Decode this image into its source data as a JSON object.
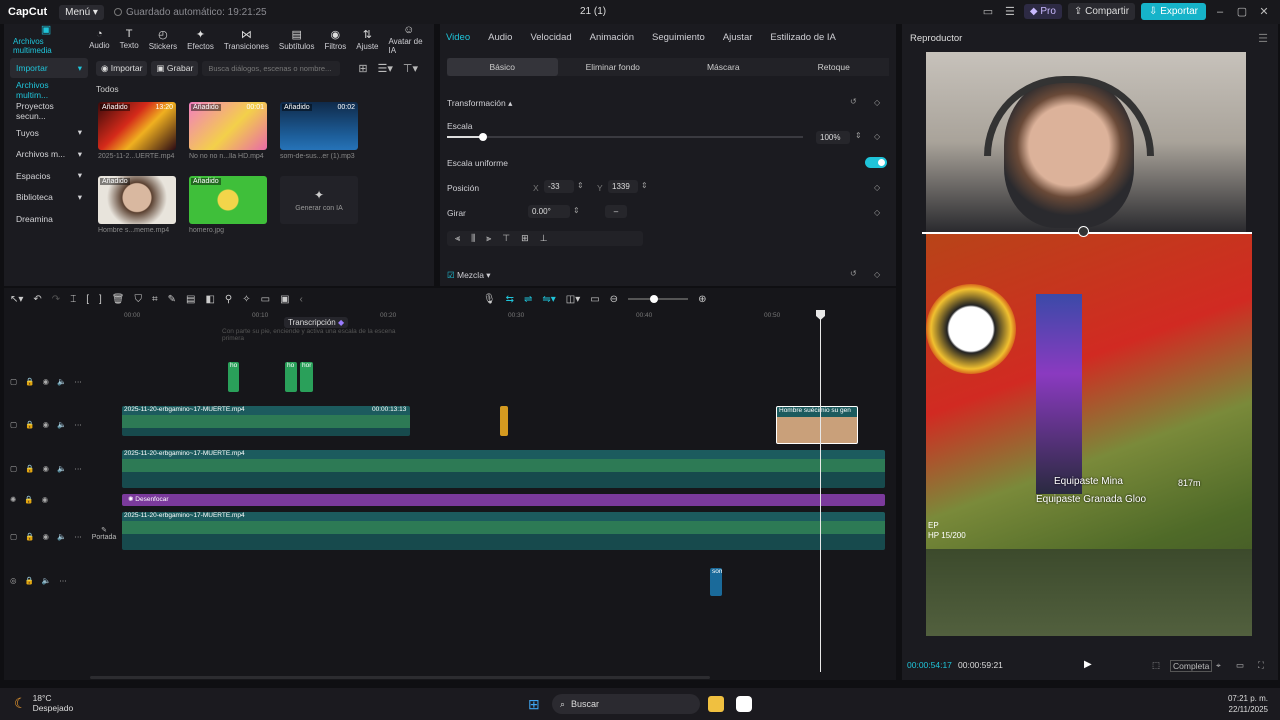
{
  "titlebar": {
    "logo": "CapCut",
    "menu": "Menú",
    "autosave": "Guardado automático: 19:21:25",
    "project": "21 (1)",
    "pro": "Pro",
    "share": "Compartir",
    "export": "Exportar"
  },
  "tools": [
    "Archivos multimedia",
    "Audio",
    "Texto",
    "Stickers",
    "Efectos",
    "Transiciones",
    "Subtítulos",
    "Filtros",
    "Ajuste",
    "Avatar de IA"
  ],
  "sidebar": [
    "Importar",
    "Archivos multim...",
    "Proyectos secun...",
    "Tuyos",
    "Archivos m...",
    "Espacios",
    "Biblioteca",
    "Dreamina"
  ],
  "media": {
    "import_btn": "Importar",
    "record_btn": "Grabar",
    "search_placeholder": "Busca diálogos, escenas o nombre...",
    "all_label": "Todos",
    "added": "Añadido",
    "items": [
      {
        "name": "2025-11-2...UERTE.mp4",
        "dur": "13:20"
      },
      {
        "name": "No no no n...lla HD.mp4",
        "dur": "00:01"
      },
      {
        "name": "som-de-sus...er (1).mp3",
        "dur": "00:02"
      },
      {
        "name": "Hombre s...meme.mp4",
        "dur": ""
      },
      {
        "name": "homero.jpg",
        "dur": ""
      },
      {
        "name": "Generar con IA",
        "dur": ""
      }
    ]
  },
  "props": {
    "tabs": [
      "Video",
      "Audio",
      "Velocidad",
      "Animación",
      "Seguimiento",
      "Ajustar",
      "Estilizado de IA"
    ],
    "subtabs": [
      "Básico",
      "Eliminar fondo",
      "Máscara",
      "Retoque"
    ],
    "transform": "Transformación",
    "scale_label": "Escala",
    "scale_value": "100%",
    "scale_fraction": 0.1,
    "uniform_label": "Escala uniforme",
    "position_label": "Posición",
    "pos_x_label": "X",
    "pos_x": "-33",
    "pos_y_label": "Y",
    "pos_y": "1339",
    "rotate_label": "Girar",
    "rotate_value": "0.00°",
    "rotate_dash": "–",
    "blend": "Mezcla"
  },
  "player": {
    "title": "Reproductor",
    "current": "00:00:54:17",
    "total": "00:00:59:21",
    "full": "Completa",
    "overlay_text1": "Equipaste Mina",
    "overlay_text2": "Equipaste Granada Gloo",
    "overlay_dist": "817m",
    "hp": "HP 15/200",
    "ep": "EP"
  },
  "timeline": {
    "ruler": [
      "00:00",
      "00:10",
      "00:20",
      "00:30",
      "00:40",
      "00:50"
    ],
    "tooltip": "Transcripción",
    "tooltip_sub": "Con parte su pie, enciende y activa una escala de la escena primera",
    "clip_label_main": "2025-11-20-erbgamino~17-MUERTE.mp4",
    "clip_label_dur": "00:00:13:13",
    "clip_short": "2025-11-2",
    "clip_meme": "Hombre suécimio su gen",
    "blur_label": "Desenfocar",
    "cover": "Portada",
    "ho": "ho",
    "hor": "hor",
    "som": "som"
  },
  "taskbar": {
    "temp": "18°C",
    "weather": "Despejado",
    "search": "Buscar",
    "time": "07:21 p. m.",
    "date": "22/11/2025"
  },
  "colors": {
    "accent": "#1fc4d9",
    "blur_track": "#7b3a9c",
    "clip_teal": "#1c5b5e"
  }
}
